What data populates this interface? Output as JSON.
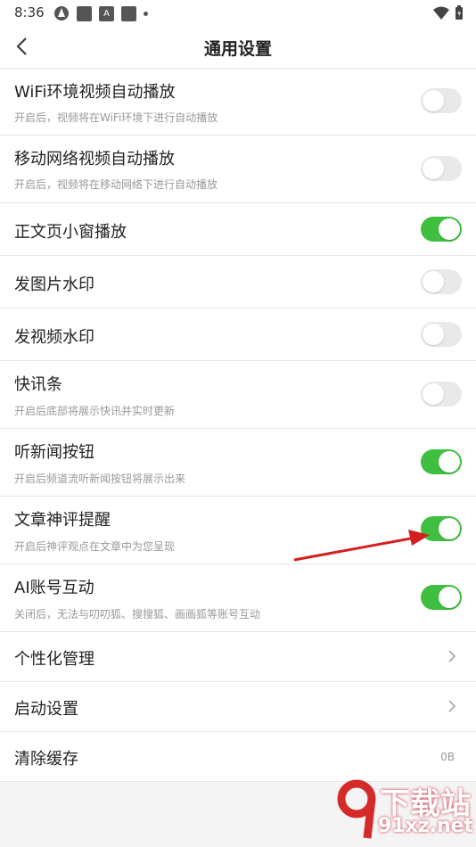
{
  "status": {
    "time": "8:36",
    "a_icon": "A"
  },
  "header": {
    "title": "通用设置",
    "back_icon": "chevron-left-icon"
  },
  "settings": [
    {
      "label": "WiFi环境视频自动播放",
      "sub": "开启后，视频将在WiFi环境下进行自动播放",
      "type": "toggle",
      "on": false
    },
    {
      "label": "移动网络视频自动播放",
      "sub": "开启后，视频将在移动网络下进行自动播放",
      "type": "toggle",
      "on": false
    },
    {
      "label": "正文页小窗播放",
      "type": "toggle",
      "on": true
    },
    {
      "label": "发图片水印",
      "type": "toggle",
      "on": false
    },
    {
      "label": "发视频水印",
      "type": "toggle",
      "on": false
    },
    {
      "label": "快讯条",
      "sub": "开启后底部将展示快讯并实时更新",
      "type": "toggle",
      "on": false
    },
    {
      "label": "听新闻按钮",
      "sub": "开启后频道流听新闻按钮将展示出来",
      "type": "toggle",
      "on": true
    },
    {
      "label": "文章神评提醒",
      "sub": "开启后神评观点在文章中为您呈现",
      "type": "toggle",
      "on": true
    },
    {
      "label": "AI账号互动",
      "sub": "关闭后，无法与叨叨狐、搜搜狐、画画狐等账号互动",
      "type": "toggle",
      "on": true
    },
    {
      "label": "个性化管理",
      "type": "link"
    },
    {
      "label": "启动设置",
      "type": "link"
    },
    {
      "label": "清除缓存",
      "type": "value",
      "value": "0B"
    }
  ],
  "colors": {
    "toggle_on": "#3fbf3f",
    "toggle_off": "#e9e9e9",
    "arrow": "#d41f1f"
  },
  "watermark": {
    "line1": "下载站",
    "line2": "91xz.net"
  }
}
